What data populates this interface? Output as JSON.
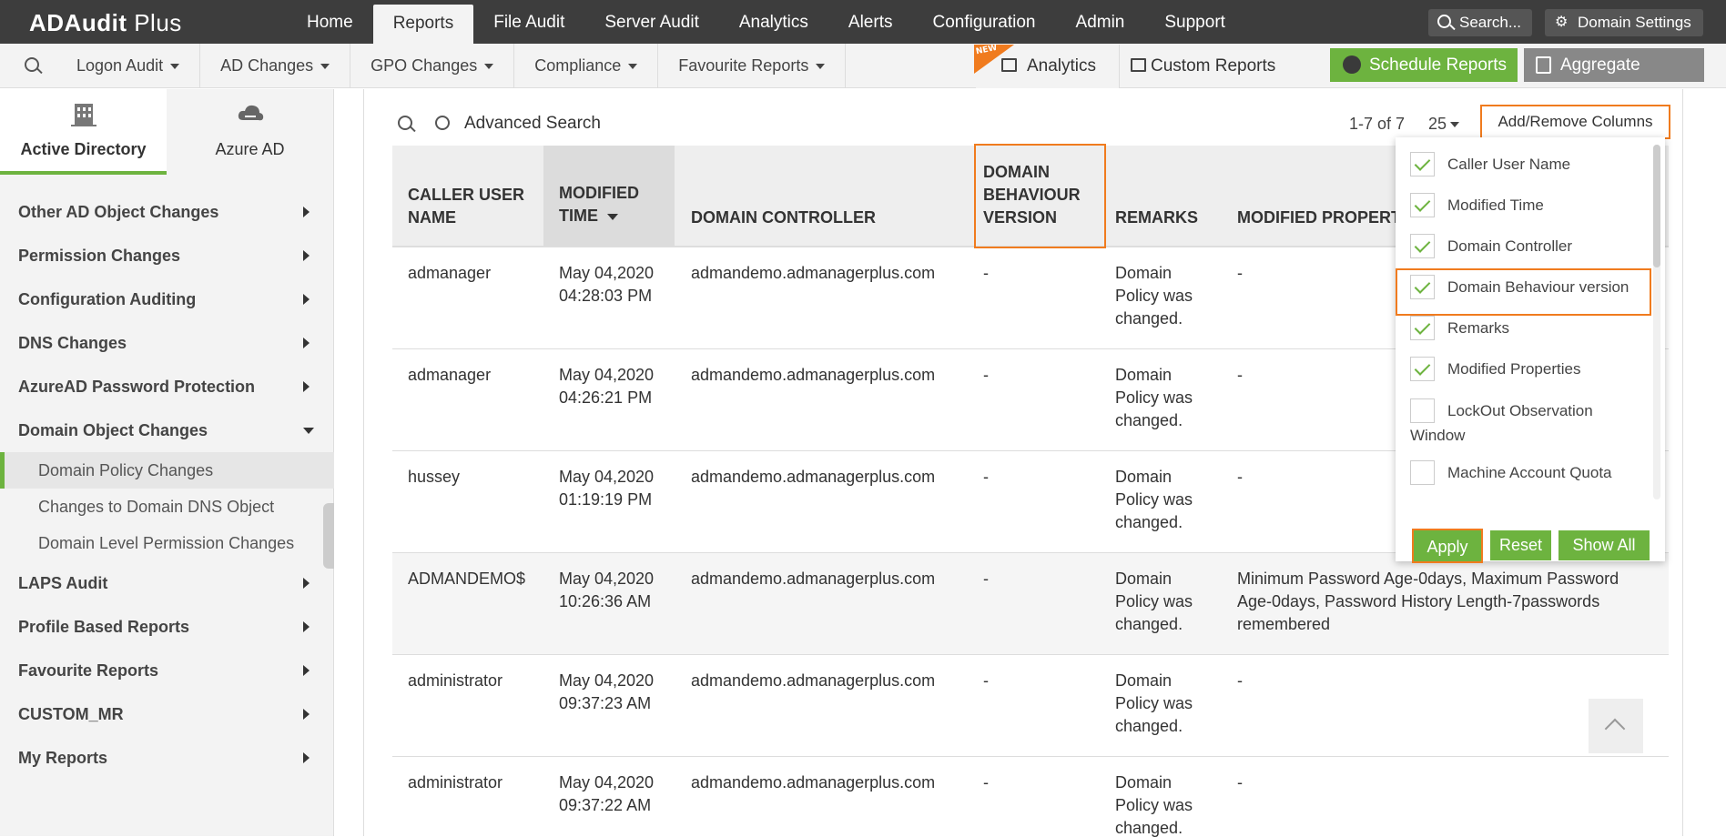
{
  "app": {
    "logo_a": "ADAudit",
    "logo_b": " Plus"
  },
  "topnav": [
    {
      "label": "Home"
    },
    {
      "label": "Reports"
    },
    {
      "label": "File Audit"
    },
    {
      "label": "Server Audit"
    },
    {
      "label": "Analytics"
    },
    {
      "label": "Alerts"
    },
    {
      "label": "Configuration"
    },
    {
      "label": "Admin"
    },
    {
      "label": "Support"
    }
  ],
  "topright": {
    "search_label": "Search...",
    "domain_label": "Domain Settings"
  },
  "subnav": [
    {
      "label": "Logon Audit"
    },
    {
      "label": "AD Changes"
    },
    {
      "label": "GPO Changes"
    },
    {
      "label": "Compliance"
    },
    {
      "label": "Favourite Reports"
    }
  ],
  "subright": {
    "new_badge": "NEW",
    "analytics_label": "Analytics",
    "custom_label": "Custom Reports",
    "schedule_label": "Schedule Reports",
    "aggregate_label": "Aggregate Reports"
  },
  "sidebar": {
    "tabs": [
      {
        "label": "Active Directory"
      },
      {
        "label": "Azure AD"
      }
    ],
    "items": [
      {
        "label": "Other AD Object Changes"
      },
      {
        "label": "Permission Changes"
      },
      {
        "label": "Configuration Auditing"
      },
      {
        "label": "DNS Changes"
      },
      {
        "label": "AzureAD Password Protection"
      },
      {
        "label": "Domain Object Changes"
      }
    ],
    "subitems": [
      {
        "label": "Domain Policy Changes"
      },
      {
        "label": "Changes to Domain DNS Object"
      },
      {
        "label": "Domain Level Permission Changes"
      }
    ],
    "items_after": [
      {
        "label": "LAPS Audit"
      },
      {
        "label": "Profile Based Reports"
      },
      {
        "label": "Favourite Reports"
      },
      {
        "label": "CUSTOM_MR"
      },
      {
        "label": "My Reports"
      }
    ]
  },
  "toolbar": {
    "advanced_search": "Advanced Search",
    "pager": "1-7 of 7",
    "per_page": "25",
    "add_remove": "Add/Remove Columns"
  },
  "table": {
    "headers": [
      "CALLER USER NAME",
      "MODIFIED TIME",
      "DOMAIN CONTROLLER",
      "DOMAIN BEHAVIOUR VERSION",
      "REMARKS",
      "MODIFIED PROPERT"
    ],
    "rows": [
      {
        "user": "admanager",
        "date": "May 04,2020",
        "time": "04:28:03 PM",
        "dc": "admandemo.admanagerplus.com",
        "dbv": "-",
        "r1": "Domain",
        "r2": "Policy was",
        "r3": "changed.",
        "mp1": "-",
        "mp2": "",
        "mp3": ""
      },
      {
        "user": "admanager",
        "date": "May 04,2020",
        "time": "04:26:21 PM",
        "dc": "admandemo.admanagerplus.com",
        "dbv": "-",
        "r1": "Domain",
        "r2": "Policy was",
        "r3": "changed.",
        "mp1": "-",
        "mp2": "",
        "mp3": ""
      },
      {
        "user": "hussey",
        "date": "May 04,2020",
        "time": "01:19:19 PM",
        "dc": "admandemo.admanagerplus.com",
        "dbv": "-",
        "r1": "Domain",
        "r2": "Policy was",
        "r3": "changed.",
        "mp1": "-",
        "mp2": "",
        "mp3": ""
      },
      {
        "user": "ADMANDEMO$",
        "date": "May 04,2020",
        "time": "10:26:36 AM",
        "dc": "admandemo.admanagerplus.com",
        "dbv": "-",
        "r1": "Domain",
        "r2": "Policy was",
        "r3": "changed.",
        "mp1": "Minimum Password Age-0days, Maximum Password",
        "mp2": "Age-0days, Password History Length-7passwords",
        "mp3": "remembered"
      },
      {
        "user": "administrator",
        "date": "May 04,2020",
        "time": "09:37:23 AM",
        "dc": "admandemo.admanagerplus.com",
        "dbv": "-",
        "r1": "Domain",
        "r2": "Policy was",
        "r3": "changed.",
        "mp1": "-",
        "mp2": "",
        "mp3": ""
      },
      {
        "user": "administrator",
        "date": "May 04,2020",
        "time": "09:37:22 AM",
        "dc": "admandemo.admanagerplus.com",
        "dbv": "-",
        "r1": "Domain",
        "r2": "Policy was",
        "r3": "changed.",
        "mp1": "-",
        "mp2": "",
        "mp3": ""
      }
    ]
  },
  "columns_panel": {
    "options": [
      {
        "label": "Caller User Name",
        "checked": true
      },
      {
        "label": "Modified Time",
        "checked": true
      },
      {
        "label": "Domain Controller",
        "checked": true
      },
      {
        "label": "Domain Behaviour version",
        "checked": true
      },
      {
        "label": "Remarks",
        "checked": true
      },
      {
        "label": "Modified Properties",
        "checked": true
      },
      {
        "label": "LockOut Observation",
        "label2": "Window",
        "checked": false
      },
      {
        "label": "Machine Account Quota",
        "checked": false
      }
    ],
    "apply": "Apply",
    "reset": "Reset",
    "show_all": "Show All"
  },
  "colors": {
    "accent_green": "#6db33f",
    "highlight_orange": "#f07b1e",
    "topbar": "#3d3d3d"
  }
}
